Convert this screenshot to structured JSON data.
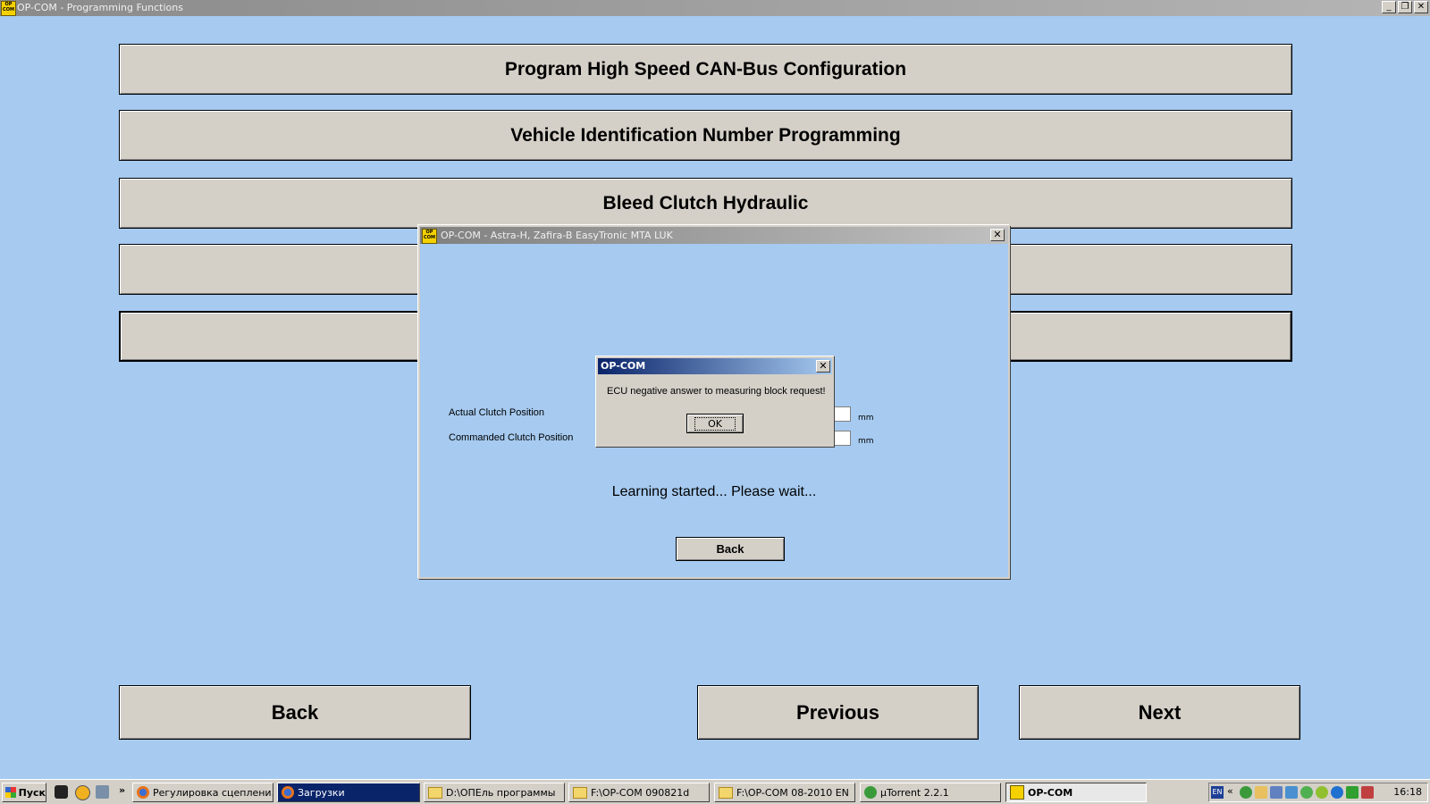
{
  "window": {
    "title": "OP-COM - Programming Functions",
    "icon_text": "OP COM"
  },
  "window_controls": {
    "minimize": "_",
    "maximize": "❐",
    "close": "✕"
  },
  "functions": [
    {
      "label": "Program High Speed CAN-Bus Configuration"
    },
    {
      "label": "Vehicle Identification Number Programming"
    },
    {
      "label": "Bleed Clutch Hydraulic"
    },
    {
      "label": ""
    },
    {
      "label": ""
    }
  ],
  "nav": {
    "back": "Back",
    "previous": "Previous",
    "next": "Next"
  },
  "dialog": {
    "title": "OP-COM - Astra-H, Zafira-B EasyTronic MTA LUK",
    "close": "✕",
    "fields": [
      {
        "label": "Actual Clutch Position",
        "value": "",
        "unit": "mm"
      },
      {
        "label": "Commanded Clutch Position",
        "value": "",
        "unit": "mm"
      }
    ],
    "status": "Learning started... Please wait...",
    "back_label": "Back"
  },
  "message_box": {
    "title": "OP-COM",
    "close": "✕",
    "text": "ECU negative answer to measuring block request!",
    "ok_label": "OK"
  },
  "taskbar": {
    "start_label": "Пуск",
    "chevron": "»",
    "tasks": [
      {
        "label": "Регулировка сцеплени...",
        "icon": "firefox-icon"
      },
      {
        "label": "Загрузки",
        "icon": "firefox-icon"
      },
      {
        "label": "D:\\ОПЕль программы",
        "icon": "folder-icon"
      },
      {
        "label": "F:\\OP-COM 090821d",
        "icon": "folder-icon"
      },
      {
        "label": "F:\\OP-COM 08-2010 EN",
        "icon": "folder-icon"
      },
      {
        "label": "µTorrent 2.2.1",
        "icon": "utorrent-icon"
      },
      {
        "label": "OP-COM",
        "icon": "opcom-icon"
      }
    ],
    "tray": {
      "lang": "EN",
      "expand": "«",
      "clock": "16:18"
    }
  },
  "colors": {
    "desktop_bg": "#a6caf0",
    "button_face": "#d4d0c8",
    "taskbar_active": "#0a246a"
  }
}
